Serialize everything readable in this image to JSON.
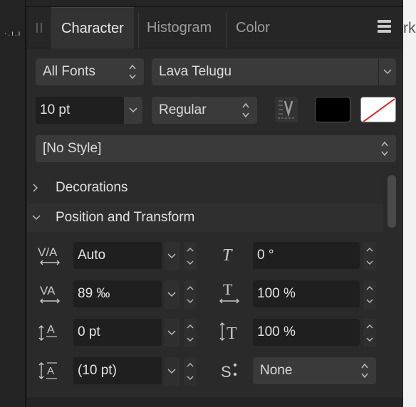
{
  "tabs": [
    {
      "label": "Character",
      "active": true
    },
    {
      "label": "Histogram",
      "active": false
    },
    {
      "label": "Color",
      "active": false
    }
  ],
  "right_edge_text": "rk",
  "font": {
    "collection": "All Fonts",
    "family": "Lava Telugu",
    "size": "10 pt",
    "style": "Regular",
    "paragraph_style": "[No Style]"
  },
  "colors": {
    "fill": "#000000",
    "stroke": "none",
    "panel_bg": "#2a2a2a",
    "field_bg": "#1f1f1f"
  },
  "sections": {
    "decorations": "Decorations",
    "position_transform": "Position and Transform"
  },
  "fields": {
    "kerning": "Auto",
    "skew": "0 °",
    "tracking": "89 ‰",
    "horizontal_scale": "100 %",
    "baseline": "0 pt",
    "vertical_scale": "100 %",
    "leading": "(10 pt)",
    "superscript": "None"
  },
  "icons": {
    "kerning": "kerning-icon",
    "skew": "italic-skew-icon",
    "tracking": "tracking-icon",
    "horizontal_scale": "horizontal-scale-icon",
    "baseline": "baseline-shift-icon",
    "vertical_scale": "vertical-scale-icon",
    "leading": "leading-icon",
    "superscript": "superscript-icon",
    "vertical_text": "vertical-text-icon",
    "menu": "hamburger-menu-icon"
  }
}
